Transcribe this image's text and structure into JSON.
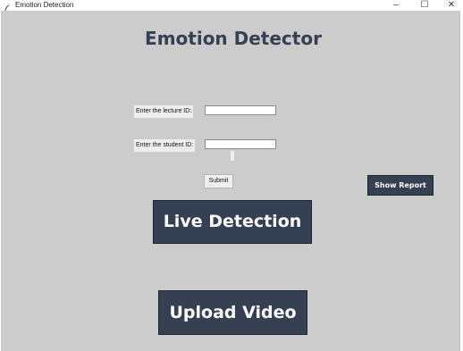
{
  "window": {
    "title": "Emotion Detection",
    "controls": {
      "minimize": "–",
      "maximize": "☐",
      "close": "✕"
    }
  },
  "main": {
    "heading": "Emotion Detector",
    "lecture_label": "Enter the lecture ID:",
    "lecture_value": "",
    "student_label": "Enter the student ID:",
    "student_value": "",
    "submit_label": "Submit",
    "show_report_label": "Show Report",
    "live_detection_label": "Live Detection",
    "upload_video_label": "Upload Video"
  },
  "colors": {
    "background": "#cccccc",
    "accent": "#354052",
    "button_text": "#ffffff"
  },
  "icons": {
    "app": "feather-icon"
  }
}
